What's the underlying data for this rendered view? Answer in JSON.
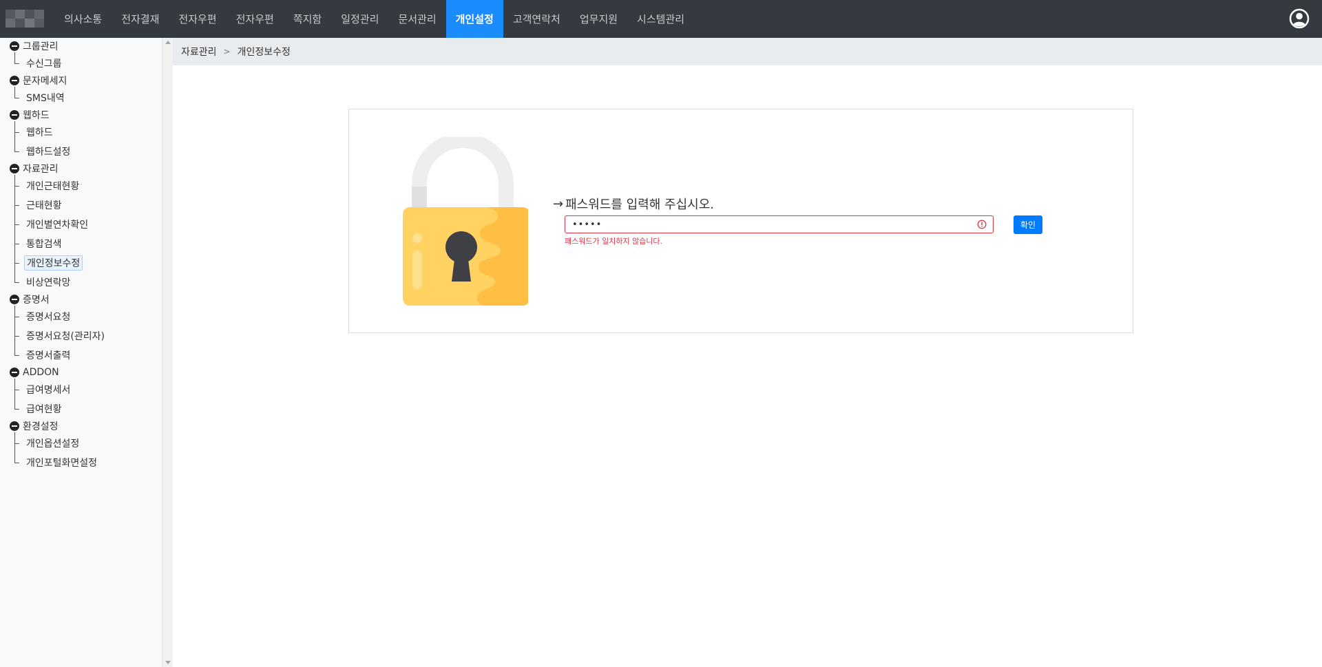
{
  "nav": {
    "items": [
      "의사소통",
      "전자결재",
      "전자우편",
      "전자우편",
      "쪽지함",
      "일정관리",
      "문서관리",
      "개인설정",
      "고객연락처",
      "업무지원",
      "시스템관리"
    ],
    "active_index": 7,
    "active_color": "#1a8cff"
  },
  "sidebar": {
    "groups": [
      {
        "label": "그룹관리",
        "items": [
          "수신그룹"
        ]
      },
      {
        "label": "문자메세지",
        "items": [
          "SMS내역"
        ]
      },
      {
        "label": "웹하드",
        "items": [
          "웹하드",
          "웹하드설정"
        ]
      },
      {
        "label": "자료관리",
        "items": [
          "개인근태현황",
          "근태현황",
          "개인별연차확인",
          "통합검색",
          "개인정보수정",
          "비상연락망"
        ]
      },
      {
        "label": "증명서",
        "items": [
          "증명서요청",
          "증명서요청(관리자)",
          "증명서출력"
        ]
      },
      {
        "label": "ADDON",
        "items": [
          "급여명세서",
          "급여현황"
        ]
      },
      {
        "label": "환경설정",
        "items": [
          "개인옵션설정",
          "개인포털화면설정"
        ]
      }
    ],
    "selected_item": "개인정보수정"
  },
  "breadcrumb": {
    "parent": "자료관리",
    "separator": ">",
    "current": "개인정보수정"
  },
  "password_form": {
    "prompt": "패스워드를 입력해 주십시오.",
    "arrow": "→",
    "value": "•••••",
    "error": "패스워드가 일치하지 않습니다.",
    "confirm_label": "확인",
    "error_color": "#dc3545",
    "button_color": "#007bff"
  },
  "icons": {
    "user": "user-circle-icon",
    "lock": "padlock-icon",
    "error": "exclamation-circle-icon"
  }
}
